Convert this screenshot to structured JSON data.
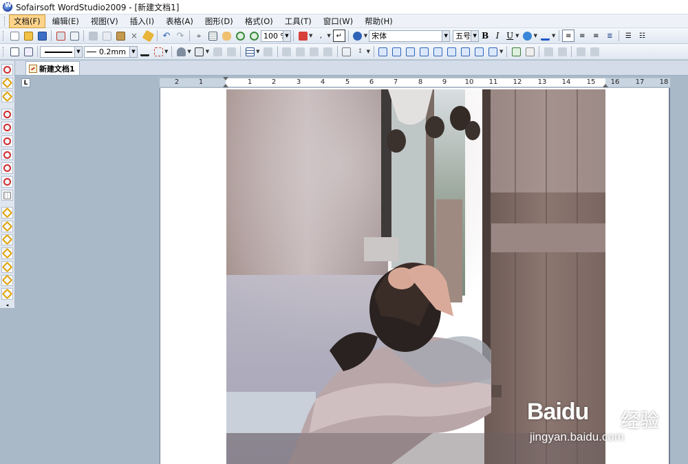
{
  "window": {
    "title": "Sofairsoft WordStudio2009 - [新建文档1]"
  },
  "menu": {
    "items": [
      {
        "label": "文档(F)",
        "active": true
      },
      {
        "label": "编辑(E)"
      },
      {
        "label": "视图(V)"
      },
      {
        "label": "插入(I)"
      },
      {
        "label": "表格(A)"
      },
      {
        "label": "图形(D)"
      },
      {
        "label": "格式(O)"
      },
      {
        "label": "工具(T)"
      },
      {
        "label": "窗口(W)"
      },
      {
        "label": "帮助(H)"
      }
    ]
  },
  "toolbar": {
    "zoom": "100 %",
    "font_name": "宋体",
    "font_size": "五号",
    "bold_label": "B",
    "italic_label": "I",
    "underline_label": "U",
    "line_width": "0.2mm",
    "icons": [
      "new-icon",
      "open-icon",
      "save-icon",
      "print-icon",
      "print-preview-icon",
      "cut-icon",
      "copy-icon",
      "paste-icon",
      "delete-icon",
      "format-painter-icon",
      "undo-icon",
      "redo-icon",
      "select-icon",
      "grid-icon",
      "pan-hand-icon",
      "zoom-in-icon",
      "zoom-out-icon",
      "insert-image-icon",
      "special-char-icon",
      "help-icon"
    ],
    "colors": {
      "font_color": "#1f56c7",
      "highlight_blue": "#2e7be0",
      "border_color": "#3b3b3b"
    }
  },
  "tabs": [
    {
      "label": "新建文档1",
      "active": true
    }
  ],
  "ruler": {
    "labels": [
      "2",
      "1",
      "1",
      "2",
      "3",
      "4",
      "5",
      "6",
      "7",
      "8",
      "9",
      "10",
      "11",
      "12",
      "13",
      "14",
      "15",
      "16",
      "17",
      "18"
    ],
    "corner_label": "L"
  },
  "document": {
    "image_description_icon": "photo-woman-at-window"
  },
  "watermark": {
    "logo_text": "Baidu",
    "logo_cn": "经验",
    "url": "jingyan.baidu.com"
  }
}
